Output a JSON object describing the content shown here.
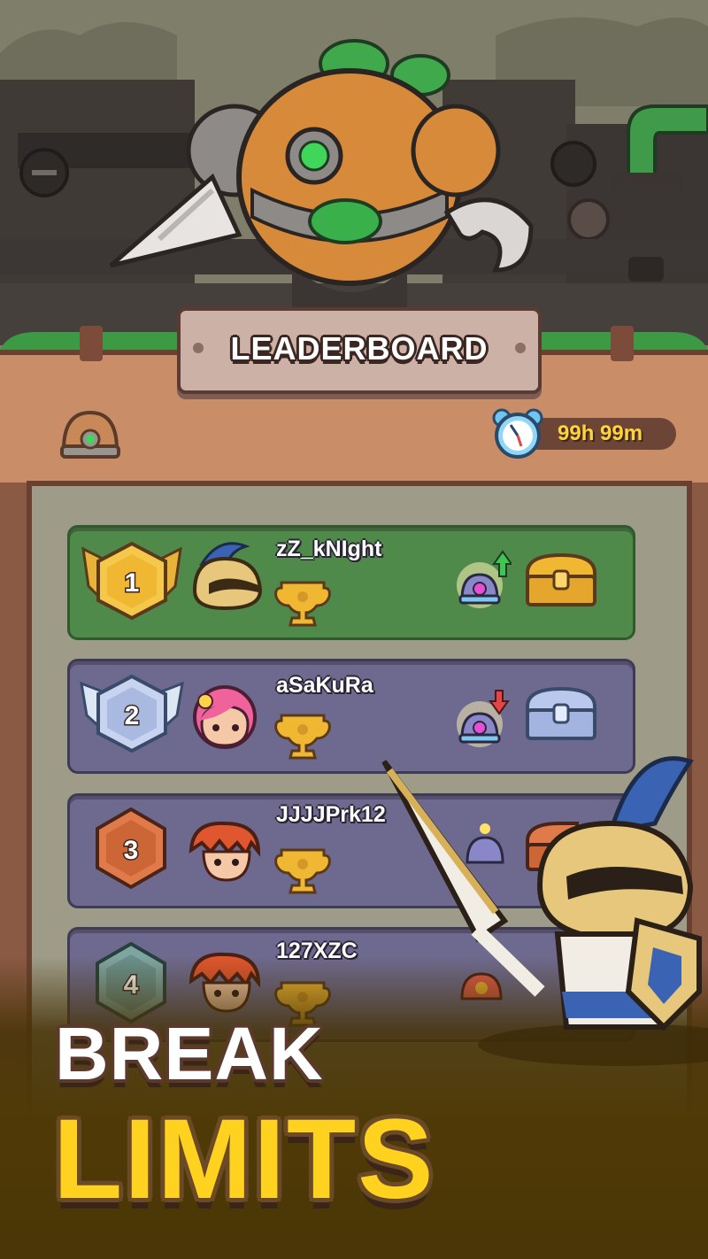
{
  "title": "LEADERBOARD",
  "timer": "99h 99m",
  "players": [
    {
      "rank": "1",
      "name": "zZ_kNIght"
    },
    {
      "rank": "2",
      "name": "aSaKuRa"
    },
    {
      "rank": "3",
      "name": "JJJJPrk12"
    },
    {
      "rank": "4",
      "name": "127XZC"
    }
  ],
  "promo": {
    "line1": "BREAK",
    "line2": "LIMITS"
  },
  "colors": {
    "first_row": "#4f8a4a",
    "other_rows": "#6e6a8f",
    "gold": "#ffd21f",
    "timer_text": "#ffd43a"
  },
  "icons": {
    "header_left": "helmet-icon",
    "timer": "alarm-clock-icon",
    "trophy": "trophy-icon",
    "rank_up": "rank-up-arrow-icon",
    "rank_down": "rank-down-arrow-icon",
    "reward": "treasure-chest-icon"
  }
}
